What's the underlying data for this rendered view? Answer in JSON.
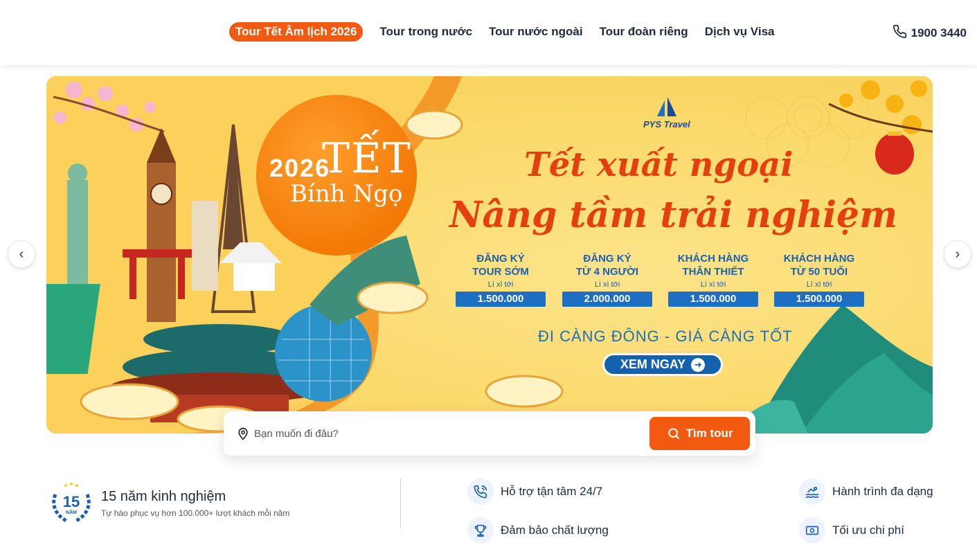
{
  "header": {
    "nav": [
      {
        "label": "Tour Tết Âm lịch 2026",
        "active": true
      },
      {
        "label": "Tour trong nước"
      },
      {
        "label": "Tour nước ngoài"
      },
      {
        "label": "Tour đoàn riêng"
      },
      {
        "label": "Dịch vụ Visa"
      }
    ],
    "phone": "1900 3440",
    "accent_color": "#f25a11"
  },
  "banner": {
    "badge_year": "2026",
    "badge_word": "TẾT",
    "badge_sub": "Bính Ngọ",
    "brand": "PYS Travel",
    "headline_1": "Tết xuất ngoại",
    "headline_2": "Nâng tầm trải nghiệm",
    "offers": [
      {
        "line1": "ĐĂNG KÝ",
        "line2": "TOUR SỚM",
        "note": "Lì xì tới",
        "amount": "1.500.000"
      },
      {
        "line1": "ĐĂNG KÝ",
        "line2": "TỪ 4 NGƯỜI",
        "note": "Lì xì tới",
        "amount": "2.000.000"
      },
      {
        "line1": "KHÁCH HÀNG",
        "line2": "THÂN THIẾT",
        "note": "Lì xì tới",
        "amount": "1.500.000"
      },
      {
        "line1": "KHÁCH HÀNG",
        "line2": "TỪ 50 TUỔI",
        "note": "Lì xì tới",
        "amount": "1.500.000"
      }
    ],
    "slogan": "ĐI CÀNG ĐÔNG - GIÁ CÀNG TỐT",
    "cta": "XEM NGAY"
  },
  "search": {
    "placeholder": "Bạn muốn đi đâu?",
    "button": "Tìm tour"
  },
  "features": {
    "experience_badge": "15",
    "experience_badge_sub": "NĂM",
    "experience_title": "15 năm kinh nghiệm",
    "experience_sub": "Tự hào phục vụ hơn 100.000+ lượt khách mỗi năm",
    "items": [
      {
        "label": "Hỗ trợ tận tâm 24/7",
        "icon": "phone-support-icon"
      },
      {
        "label": "Hành trình đa dạng",
        "icon": "swim-icon"
      },
      {
        "label": "Đảm bảo chất lượng",
        "icon": "trophy-icon"
      },
      {
        "label": "Tối ưu chi phí",
        "icon": "money-icon"
      }
    ]
  }
}
